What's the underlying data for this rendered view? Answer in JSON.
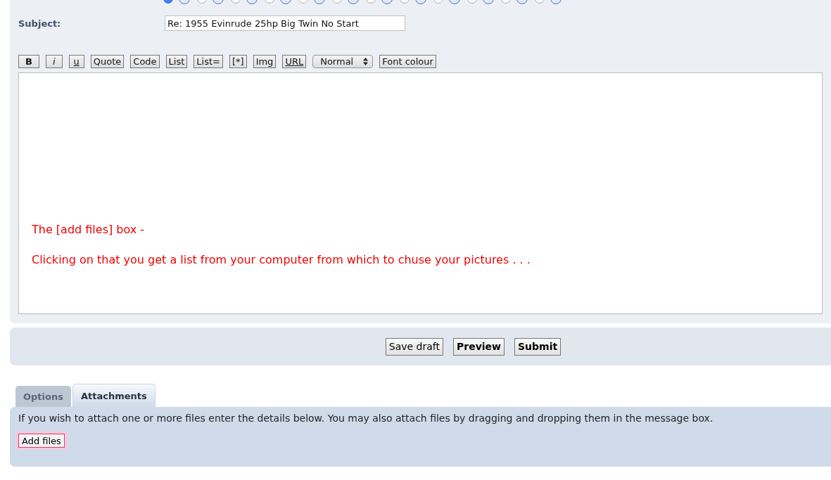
{
  "smilies": [
    {
      "selected": true
    },
    {
      "selected": false
    },
    {
      "selected": false
    },
    {
      "selected": false
    },
    {
      "selected": false
    },
    {
      "selected": false
    },
    {
      "selected": false
    },
    {
      "selected": false
    },
    {
      "selected": false
    },
    {
      "selected": false
    },
    {
      "selected": false
    },
    {
      "selected": false
    }
  ],
  "subject": {
    "label": "Subject:",
    "value": "Re: 1955 Evinrude 25hp Big Twin No Start"
  },
  "toolbar": [
    {
      "label": "B",
      "kind": "bold"
    },
    {
      "label": "i",
      "kind": "italic"
    },
    {
      "label": "u",
      "kind": "underline"
    },
    {
      "label": "Quote",
      "kind": "plain"
    },
    {
      "label": "Code",
      "kind": "plain"
    },
    {
      "label": "List",
      "kind": "plain"
    },
    {
      "label": "List=",
      "kind": "plain"
    },
    {
      "label": "[*]",
      "kind": "plain"
    },
    {
      "label": "Img",
      "kind": "plain"
    },
    {
      "label": "URL",
      "kind": "underline"
    },
    {
      "label": "Normal",
      "kind": "select"
    },
    {
      "label": "Font colour",
      "kind": "plain"
    }
  ],
  "message": {
    "value": "The [add files] box -\n\nClicking on that you get a list from your computer from which to chuse your pictures . . ."
  },
  "actions": [
    {
      "label": "Save draft",
      "kind": "plain"
    },
    {
      "label": "Preview",
      "kind": "bold"
    },
    {
      "label": "Submit",
      "kind": "bold"
    }
  ],
  "tabs": [
    {
      "label": "Options",
      "selected": false
    },
    {
      "label": "Attachments",
      "selected": true
    }
  ],
  "attachments": {
    "text": "If you wish to attach one or more files enter the details below. You may also attach files by dragging and dropping them in the message box.",
    "button": "Add files"
  }
}
